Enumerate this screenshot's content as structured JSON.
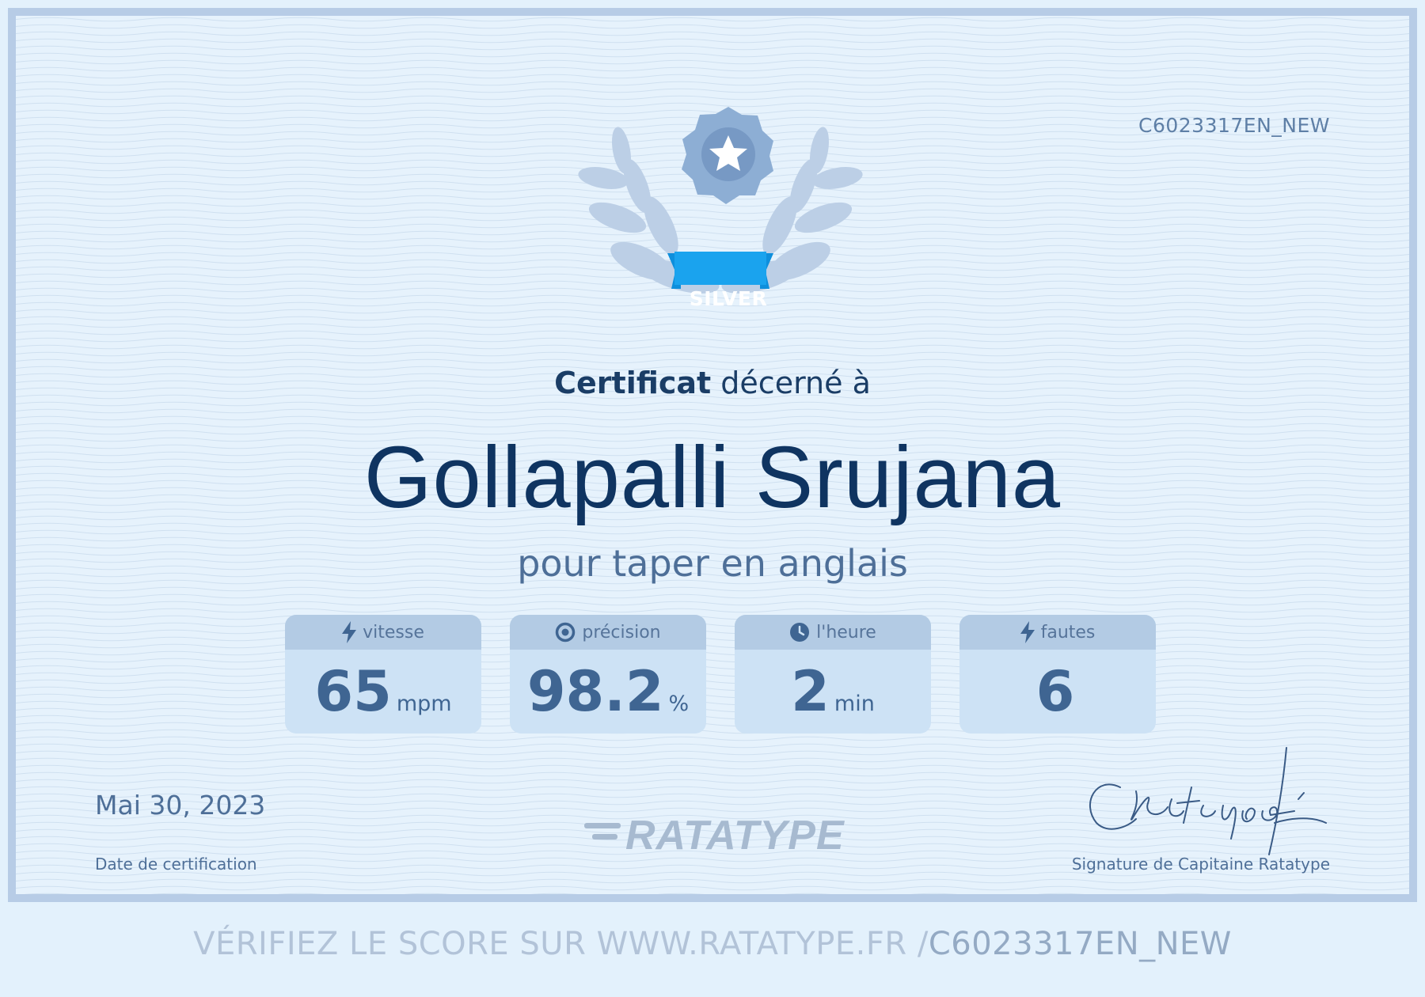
{
  "certificate": {
    "id": "C6023317EN_NEW",
    "badge": "SILVER",
    "awarded_bold": "Certificat",
    "awarded_rest": " décerné à",
    "recipient": "Gollapalli Srujana",
    "subtitle": "pour taper en anglais"
  },
  "stats": [
    {
      "label": "vitesse",
      "icon": "lightning-icon",
      "value": "65",
      "unit": "mpm"
    },
    {
      "label": "précision",
      "icon": "target-icon",
      "value": "98.2",
      "unit": "%"
    },
    {
      "label": "l'heure",
      "icon": "clock-icon",
      "value": "2",
      "unit": "min"
    },
    {
      "label": "fautes",
      "icon": "lightning-icon",
      "value": "6",
      "unit": ""
    }
  ],
  "footer": {
    "date": "Mai 30, 2023",
    "date_label": "Date de certification",
    "logo": "RATATYPE",
    "signature_label": "Signature de Capitaine Ratatype",
    "verify_prefix": "VÉRIFIEZ LE SCORE SUR WWW.RATATYPE.FR /",
    "verify_code": "C6023317EN_NEW"
  },
  "colors": {
    "background": "#e6f2fc",
    "border": "#b7cce6",
    "name": "#0f3461",
    "badge": "#1aa3ee",
    "emblem": "#7fa3cc"
  }
}
